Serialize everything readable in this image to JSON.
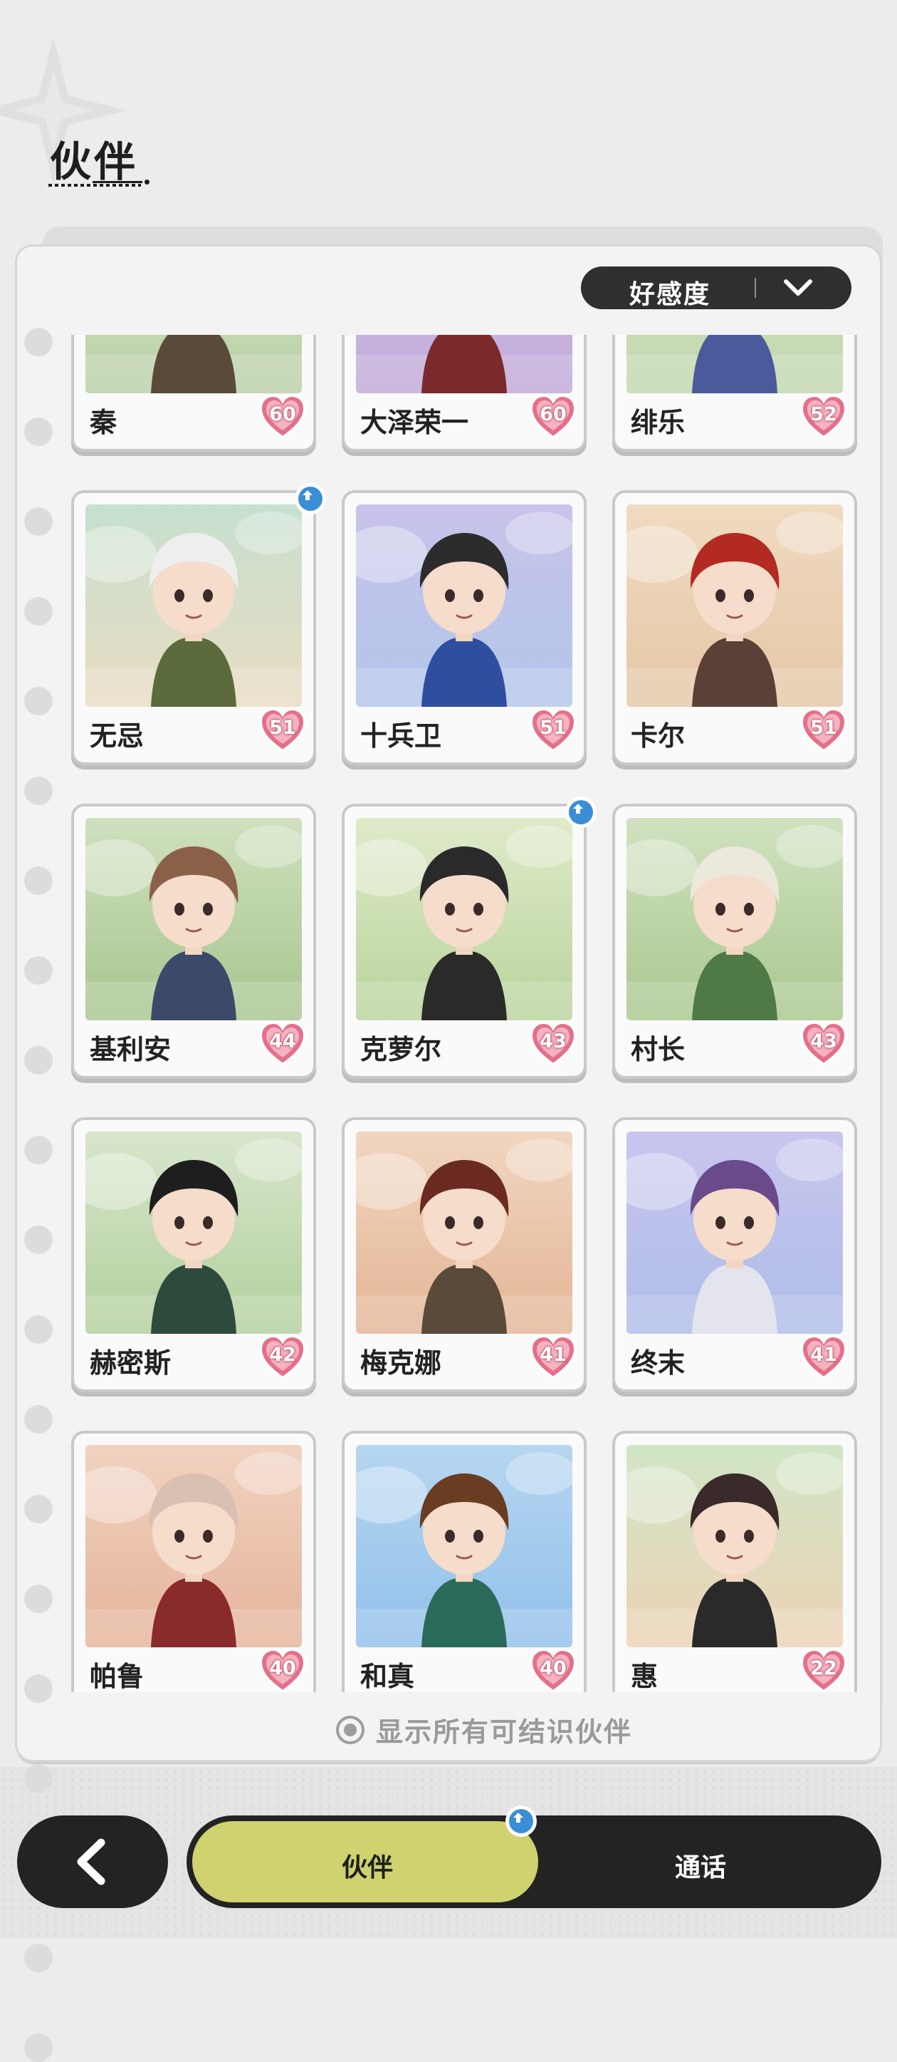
{
  "header": {
    "title": "伙伴"
  },
  "sort": {
    "label": "好感度",
    "icon": "chevron-down-icon"
  },
  "colors": {
    "accent": "#cfd26e",
    "dark": "#232323",
    "heart": "#e56f89",
    "badge": "#3a8ed6"
  },
  "partners": [
    {
      "name": "秦",
      "affinity": "60",
      "upgrade": false,
      "bg": [
        "#d9e7c9",
        "#b9cfa6"
      ],
      "hair": "#3a3a3a",
      "outfit": "#5a4a3a"
    },
    {
      "name": "大泽荣一",
      "affinity": "60",
      "upgrade": false,
      "bg": [
        "#d6c8e8",
        "#c0a8d8"
      ],
      "hair": "#7a2c2c",
      "outfit": "#7a2a2a"
    },
    {
      "name": "绯乐",
      "affinity": "52",
      "upgrade": false,
      "bg": [
        "#d7e6cc",
        "#c1d6ac"
      ],
      "hair": "#e8e6e0",
      "outfit": "#4a5a9a"
    },
    {
      "name": "无忌",
      "affinity": "51",
      "upgrade": true,
      "bg": [
        "#c6e0cf",
        "#e9dcc2"
      ],
      "hair": "#eeeeee",
      "outfit": "#5b6b3b"
    },
    {
      "name": "十兵卫",
      "affinity": "51",
      "upgrade": false,
      "bg": [
        "#c8c3ea",
        "#b2c6ea"
      ],
      "hair": "#2c2c2c",
      "outfit": "#2f4ea0"
    },
    {
      "name": "卡尔",
      "affinity": "51",
      "upgrade": false,
      "bg": [
        "#f0dac0",
        "#e5c7a7"
      ],
      "hair": "#b22a22",
      "outfit": "#5a4037"
    },
    {
      "name": "基利安",
      "affinity": "44",
      "upgrade": false,
      "bg": [
        "#cfe0bd",
        "#a8c58f"
      ],
      "hair": "#8a6048",
      "outfit": "#3c4a6a"
    },
    {
      "name": "克萝尔",
      "affinity": "43",
      "upgrade": true,
      "bg": [
        "#dfeac9",
        "#b9d49c"
      ],
      "hair": "#2a2a2a",
      "outfit": "#2a2a2a"
    },
    {
      "name": "村长",
      "affinity": "43",
      "upgrade": false,
      "bg": [
        "#d0e2c0",
        "#a9c78f"
      ],
      "hair": "#ece8dc",
      "outfit": "#4f7a46"
    },
    {
      "name": "赫密斯",
      "affinity": "42",
      "upgrade": false,
      "bg": [
        "#d8e6cc",
        "#b2cf9d"
      ],
      "hair": "#1e1e1e",
      "outfit": "#2e4a3c"
    },
    {
      "name": "梅克娜",
      "affinity": "41",
      "upgrade": false,
      "bg": [
        "#f1d6c0",
        "#e3b595"
      ],
      "hair": "#6a2a22",
      "outfit": "#5a4a3a"
    },
    {
      "name": "终末",
      "affinity": "41",
      "upgrade": false,
      "bg": [
        "#c8c6ee",
        "#aebde8"
      ],
      "hair": "#6a4a8a",
      "outfit": "#e4e4ef"
    },
    {
      "name": "帕鲁",
      "affinity": "40",
      "upgrade": false,
      "bg": [
        "#f1d2c0",
        "#e5b49a"
      ],
      "hair": "#d8c0b2",
      "outfit": "#8a2a2a"
    },
    {
      "name": "和真",
      "affinity": "40",
      "upgrade": false,
      "bg": [
        "#b6d6f0",
        "#92c0ea"
      ],
      "hair": "#6a3c22",
      "outfit": "#2a6a5a"
    },
    {
      "name": "惠",
      "affinity": "22",
      "upgrade": false,
      "bg": [
        "#cfe6c6",
        "#eed2b5"
      ],
      "hair": "#3a2a2a",
      "outfit": "#2a2a2a"
    }
  ],
  "show_all": {
    "label": "显示所有可结识伙伴"
  },
  "nav": {
    "back_icon": "back-arrow-icon",
    "tab_partner": "伙伴",
    "tab_call": "通话"
  }
}
